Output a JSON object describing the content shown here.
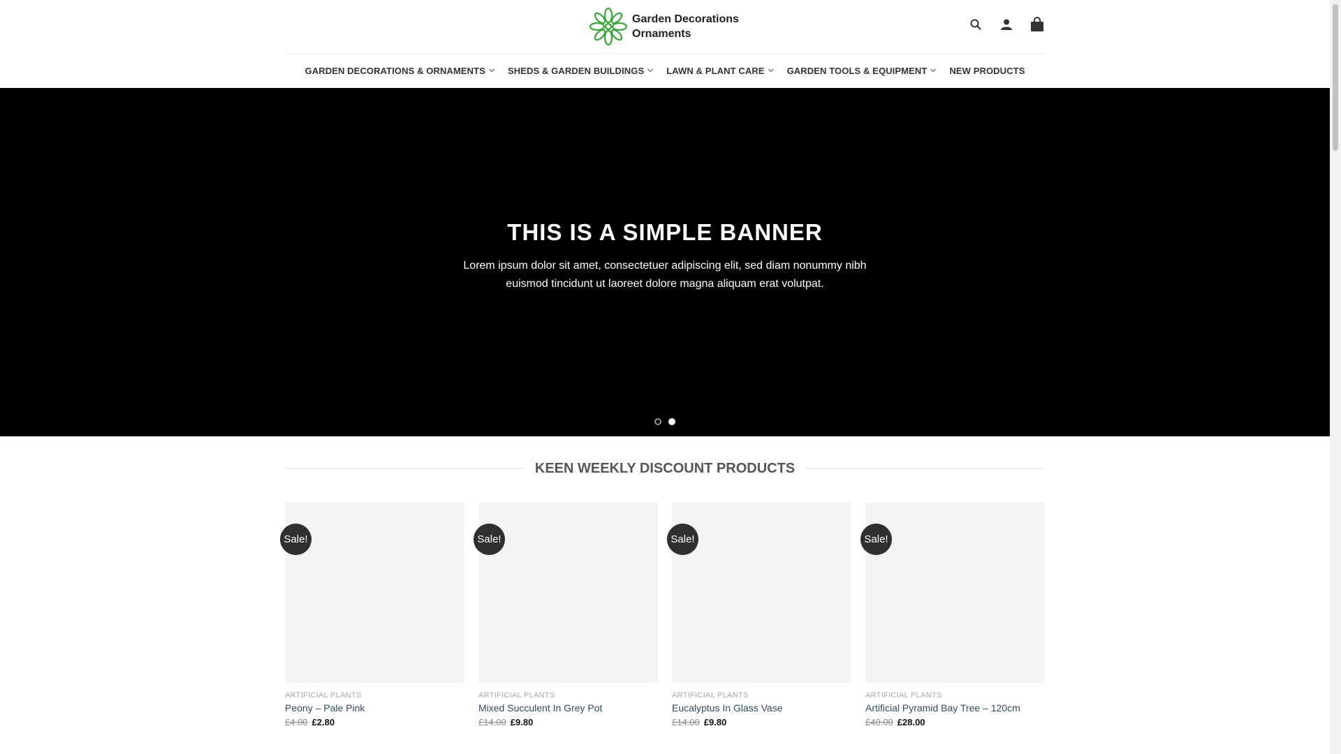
{
  "header": {
    "logo_line1": "Garden Decorations",
    "logo_line2": "Ornaments",
    "brand_color": "#3aa63a"
  },
  "nav": {
    "items": [
      {
        "label": "GARDEN DECORATIONS & ORNAMENTS",
        "has_dropdown": true
      },
      {
        "label": "SHEDS & GARDEN BUILDINGS",
        "has_dropdown": true
      },
      {
        "label": "LAWN & PLANT CARE",
        "has_dropdown": true
      },
      {
        "label": "GARDEN TOOLS & EQUIPMENT",
        "has_dropdown": true
      },
      {
        "label": "NEW PRODUCTS",
        "has_dropdown": false
      }
    ]
  },
  "banner": {
    "title": "THIS IS A SIMPLE BANNER",
    "text": "Lorem ipsum dolor sit amet, consectetuer adipiscing elit, sed diam nonummy nibh euismod tincidunt ut laoreet dolore magna aliquam erat volutpat.",
    "slides": 2,
    "active_slide": 2
  },
  "section": {
    "title": "KEEN WEEKLY DISCOUNT PRODUCTS"
  },
  "products": [
    {
      "badge": "Sale!",
      "category": "ARTIFICIAL PLANTS",
      "name": "Peony – Pale Pink",
      "old_price": "£4.00",
      "new_price": "£2.80"
    },
    {
      "badge": "Sale!",
      "category": "ARTIFICIAL PLANTS",
      "name": "Mixed Succulent In Grey Pot",
      "old_price": "£14.00",
      "new_price": "£9.80"
    },
    {
      "badge": "Sale!",
      "category": "ARTIFICIAL PLANTS",
      "name": "Eucalyptus In Glass Vase",
      "old_price": "£14.00",
      "new_price": "£9.80"
    },
    {
      "badge": "Sale!",
      "category": "ARTIFICIAL PLANTS",
      "name": "Artificial Pyramid Bay Tree – 120cm",
      "old_price": "£40.00",
      "new_price": "£28.00"
    }
  ]
}
